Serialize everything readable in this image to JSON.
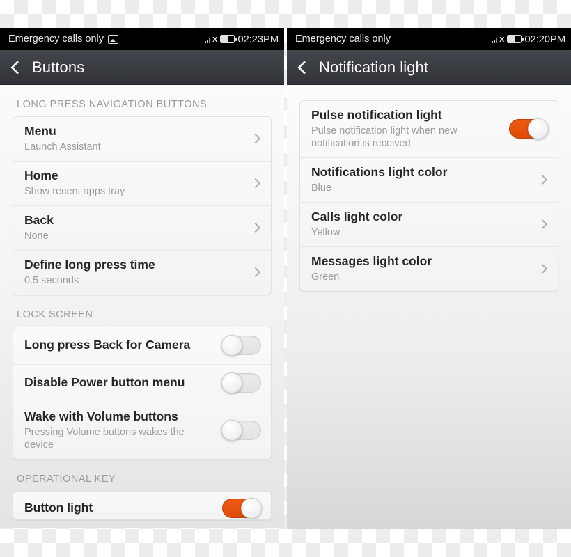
{
  "left_phone": {
    "status_bar": {
      "carrier": "Emergency calls only",
      "screenshot_icon": "screenshot-icon",
      "signal_icon": "signal-bars-icon",
      "nosim_icon": "no-sim-icon",
      "battery_icon": "battery-icon",
      "time": "02:23PM"
    },
    "action_bar": {
      "back_icon": "back-chevron-icon",
      "title": "Buttons"
    },
    "sections": [
      {
        "label": "LONG PRESS NAVIGATION BUTTONS",
        "rows": [
          {
            "title": "Menu",
            "subtitle": "Launch Assistant",
            "accessory": "chevron"
          },
          {
            "title": "Home",
            "subtitle": "Show recent apps tray",
            "accessory": "chevron"
          },
          {
            "title": "Back",
            "subtitle": "None",
            "accessory": "chevron"
          },
          {
            "title": "Define long press time",
            "subtitle": "0.5 seconds",
            "accessory": "chevron"
          }
        ]
      },
      {
        "label": "LOCK SCREEN",
        "rows": [
          {
            "title": "Long press Back for Camera",
            "subtitle": "",
            "accessory": "toggle",
            "toggle_on": false
          },
          {
            "title": "Disable Power button menu",
            "subtitle": "",
            "accessory": "toggle",
            "toggle_on": false
          },
          {
            "title": "Wake with Volume buttons",
            "subtitle": "Pressing Volume buttons wakes the device",
            "accessory": "toggle",
            "toggle_on": false
          }
        ]
      },
      {
        "label": "OPERATIONAL KEY",
        "rows": [
          {
            "title": "Button light",
            "subtitle": "",
            "accessory": "toggle",
            "toggle_on": true
          }
        ]
      }
    ]
  },
  "right_phone": {
    "status_bar": {
      "carrier": "Emergency calls only",
      "signal_icon": "signal-bars-icon",
      "nosim_icon": "no-sim-icon",
      "battery_icon": "battery-icon",
      "time": "02:20PM"
    },
    "action_bar": {
      "back_icon": "back-chevron-icon",
      "title": "Notification light"
    },
    "sections": [
      {
        "label": "",
        "rows": [
          {
            "title": "Pulse notification light",
            "subtitle": "Pulse notification light when new notification is received",
            "accessory": "toggle",
            "toggle_on": true
          },
          {
            "title": "Notifications light color",
            "subtitle": "Blue",
            "accessory": "chevron"
          },
          {
            "title": "Calls light color",
            "subtitle": "Yellow",
            "accessory": "chevron"
          },
          {
            "title": "Messages light color",
            "subtitle": "Green",
            "accessory": "chevron"
          }
        ]
      }
    ]
  },
  "colors": {
    "accent_orange": "#e2500d",
    "status_bar_bg": "#000000",
    "action_bar_bg": "#3a3d42",
    "title_text": "#262626",
    "subtitle_text": "#9c9c9c",
    "section_label_text": "#9b9b9b"
  }
}
